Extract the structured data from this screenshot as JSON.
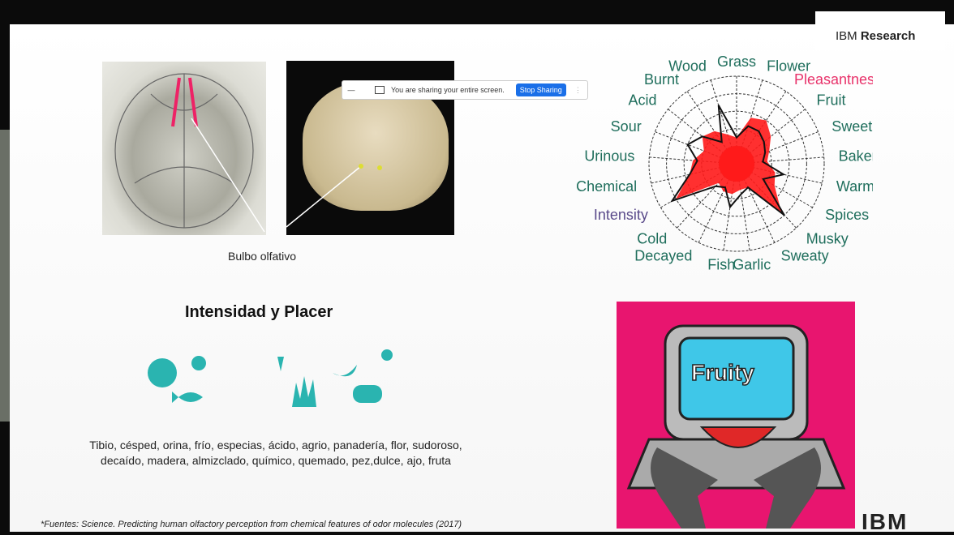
{
  "header": {
    "brand_light": "IBM",
    "brand_bold": "Research"
  },
  "share_bar": {
    "message": "You are sharing your entire screen.",
    "stop_label": "Stop Sharing",
    "minimize_icon": "minus-icon",
    "screen_icon": "screen-share-icon"
  },
  "slide": {
    "caption": "Bulbo olfativo",
    "section_title": "Intensidad y Placer",
    "descriptors_line1": "Tibio, césped, orina, frío, especias, ácido, agrio, panadería, flor, sudoroso,",
    "descriptors_line2": "decaído, madera, almizclado, químico, quemado, pez,dulce, ajo, fruta",
    "footnote": "*Fuentes: Science. Predicting human olfactory perception from chemical features of odor molecules (2017)",
    "fruity_label": "Fruity",
    "logo": "IBM"
  },
  "chart_data": {
    "type": "radar",
    "axes": [
      "Grass",
      "Flower",
      "Pleasantness",
      "Fruit",
      "Sweet",
      "Bakery",
      "Warm",
      "Spices",
      "Musky",
      "Sweaty",
      "Garlic",
      "Fish",
      "Decayed",
      "Cold",
      "Intensity",
      "Chemical",
      "Urinous",
      "Sour",
      "Acid",
      "Burnt",
      "Wood"
    ],
    "axis_label_display": [
      "Grass",
      "Flower",
      "Pleasantne",
      "Fruit",
      "Sweet",
      "Baker",
      "Warm",
      "Spices",
      "Musky",
      "Sweaty",
      "Garlic",
      "Fish",
      "Decayed",
      "Cold",
      "Intensity",
      "Chemical",
      "Urinous",
      "Sour",
      "Acid",
      "Burnt",
      "Wood"
    ],
    "rings": 5,
    "range": [
      0,
      1
    ],
    "series": [
      {
        "color": "#ff1a1a",
        "values": [
          0.3,
          0.55,
          0.6,
          0.5,
          0.4,
          0.35,
          0.45,
          0.5,
          0.75,
          0.3,
          0.3,
          0.35,
          0.35,
          0.3,
          0.8,
          0.55,
          0.5,
          0.4,
          0.5,
          0.45,
          0.35
        ]
      },
      {
        "color": "#111111",
        "values": [
          0.3,
          0.45,
          0.45,
          0.4,
          0.35,
          0.3,
          0.55,
          0.35,
          0.8,
          0.3,
          0.35,
          0.5,
          0.3,
          0.35,
          0.85,
          0.55,
          0.45,
          0.6,
          0.5,
          0.3,
          0.7
        ]
      }
    ],
    "label_color": "#1f6e5c",
    "highlight_colors": {
      "Pleasantness": "#e8326a",
      "Intensity": "#5a4a8a"
    }
  }
}
